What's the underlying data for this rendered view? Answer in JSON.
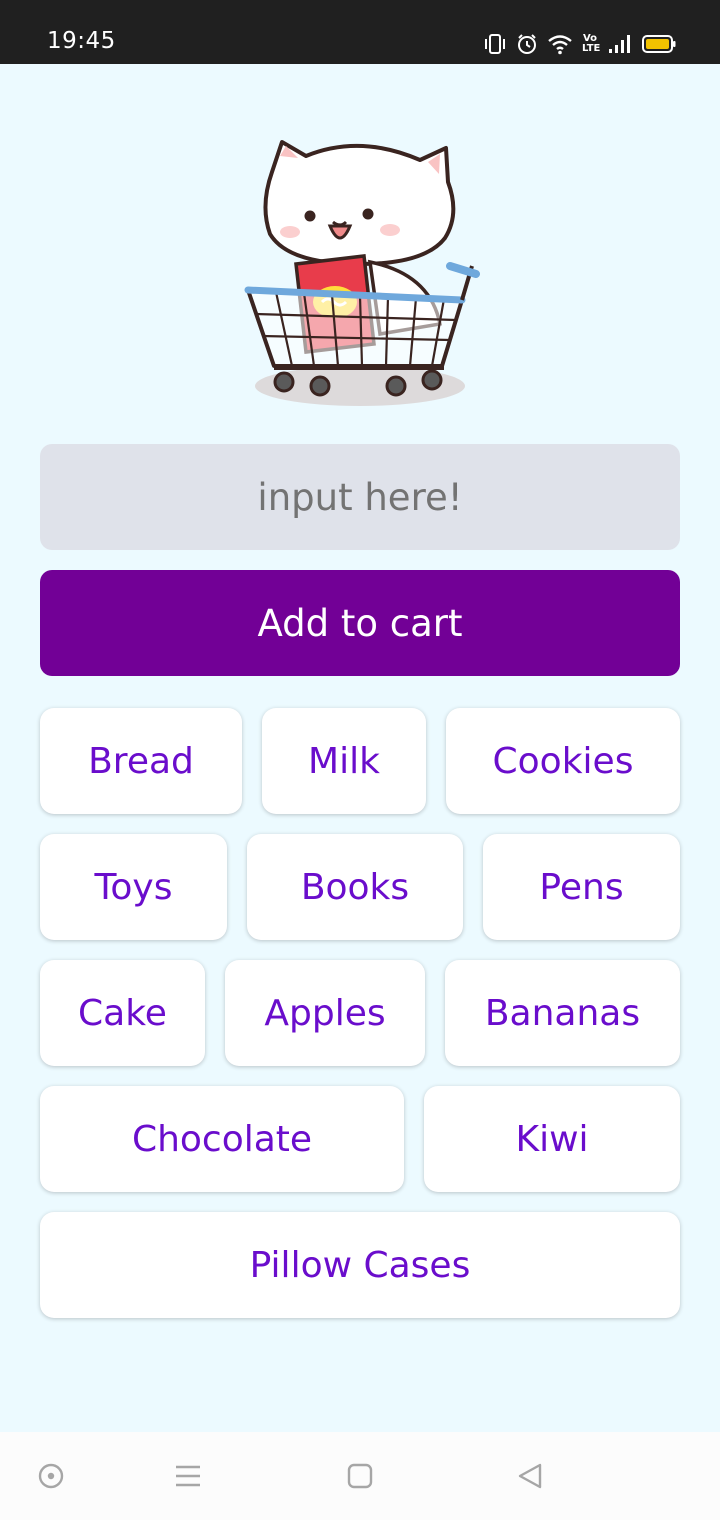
{
  "status_bar": {
    "time": "19:45",
    "icons": [
      "vibrate-icon",
      "alarm-icon",
      "wifi-icon",
      "volte-icon",
      "signal-icon",
      "battery-icon"
    ],
    "volte_text": "Vo LTE"
  },
  "illustration": {
    "icon": "cat-in-shopping-cart-icon"
  },
  "input": {
    "placeholder": "input here!",
    "value": ""
  },
  "add_button": {
    "label": "Add to cart",
    "color": "#720096"
  },
  "items": [
    [
      "Bread",
      "Milk",
      "Cookies"
    ],
    [
      "Toys",
      "Books",
      "Pens"
    ],
    [
      "Cake",
      "Apples",
      "Bananas"
    ],
    [
      "Chocolate",
      "Kiwi"
    ],
    [
      "Pillow Cases"
    ]
  ],
  "colors": {
    "background": "#ecfaff",
    "chip_text": "#6a0dcc",
    "input_bg": "#dfe2ea"
  },
  "nav_bar": {
    "buttons": [
      "assistant-icon",
      "menu-icon",
      "home-icon",
      "back-icon"
    ]
  }
}
